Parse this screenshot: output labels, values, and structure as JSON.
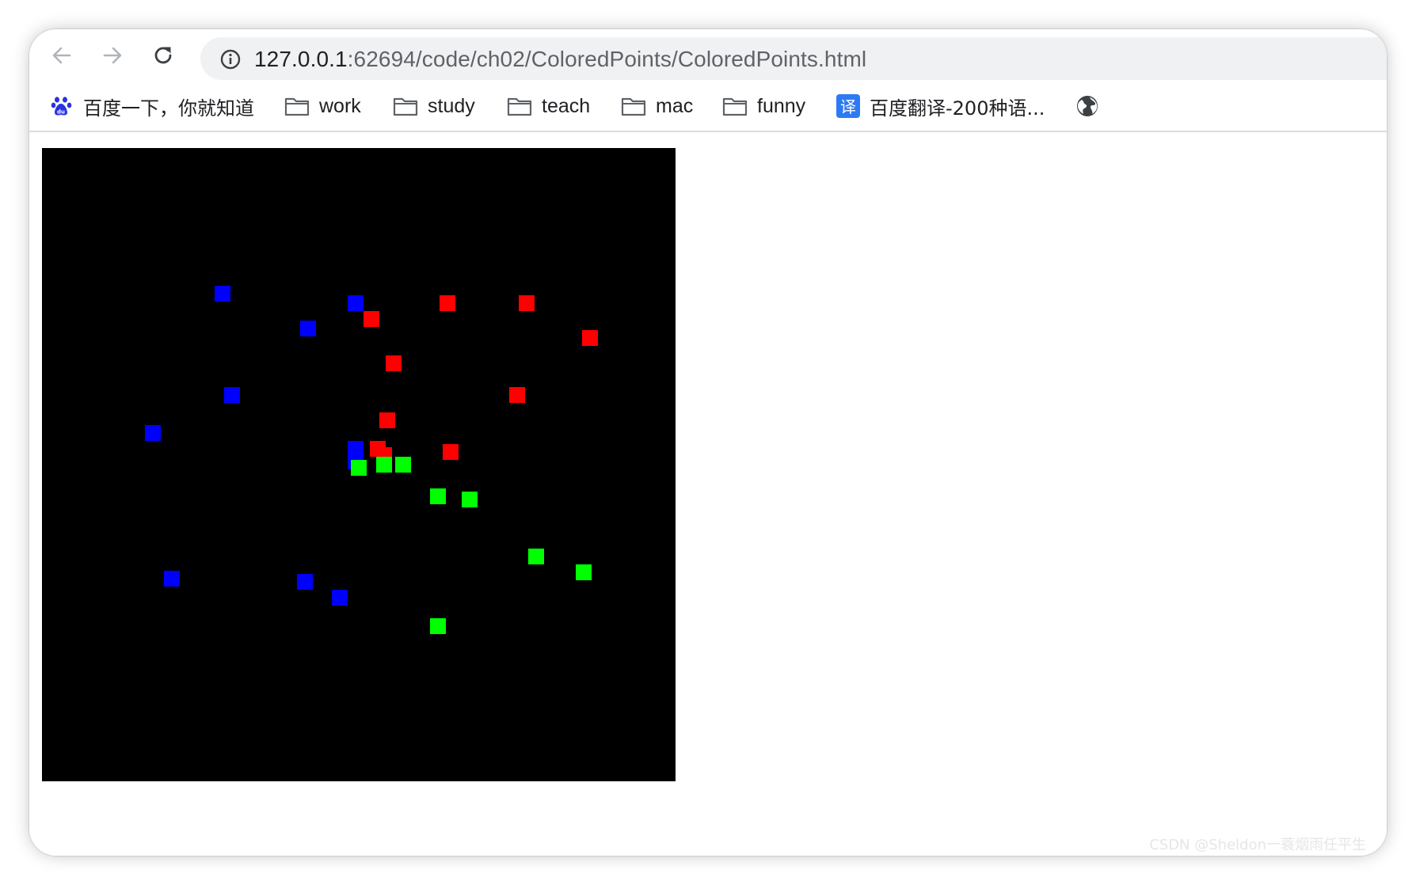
{
  "browser": {
    "url_host": "127.0.0.1",
    "url_rest": ":62694/code/ch02/ColoredPoints/ColoredPoints.html",
    "nav": {
      "back_icon": "back-arrow-icon",
      "forward_icon": "forward-arrow-icon",
      "reload_icon": "reload-icon",
      "site_info_icon": "info-circle-icon"
    }
  },
  "bookmarks": [
    {
      "label": "百度一下，你就知道",
      "icon": "baidu-paw-icon"
    },
    {
      "label": "work",
      "icon": "folder-icon"
    },
    {
      "label": "study",
      "icon": "folder-icon"
    },
    {
      "label": "teach",
      "icon": "folder-icon"
    },
    {
      "label": "mac",
      "icon": "folder-icon"
    },
    {
      "label": "funny",
      "icon": "folder-icon"
    },
    {
      "label": "百度翻译-200种语...",
      "icon": "translate-icon",
      "icon_text": "译"
    },
    {
      "label": "",
      "icon": "globe-icon"
    }
  ],
  "canvas": {
    "background": "#000000",
    "colors": {
      "red": "#ff0000",
      "green": "#00ff00",
      "blue": "#0000ff"
    },
    "points": [
      {
        "color": "blue",
        "x": -0.43,
        "y": 0.54
      },
      {
        "color": "blue",
        "x": -0.01,
        "y": 0.51
      },
      {
        "color": "red",
        "x": 0.04,
        "y": 0.46
      },
      {
        "color": "red",
        "x": 0.28,
        "y": 0.51
      },
      {
        "color": "red",
        "x": 0.53,
        "y": 0.51
      },
      {
        "color": "blue",
        "x": -0.16,
        "y": 0.43
      },
      {
        "color": "red",
        "x": 0.73,
        "y": 0.4
      },
      {
        "color": "red",
        "x": 0.11,
        "y": 0.32
      },
      {
        "color": "blue",
        "x": -0.4,
        "y": 0.22
      },
      {
        "color": "red",
        "x": 0.5,
        "y": 0.22
      },
      {
        "color": "red",
        "x": 0.09,
        "y": 0.14
      },
      {
        "color": "blue",
        "x": -0.65,
        "y": 0.1
      },
      {
        "color": "blue",
        "x": -0.01,
        "y": 0.05
      },
      {
        "color": "red",
        "x": 0.06,
        "y": 0.05
      },
      {
        "color": "red",
        "x": 0.08,
        "y": 0.03
      },
      {
        "color": "red",
        "x": 0.29,
        "y": 0.04
      },
      {
        "color": "blue",
        "x": -0.01,
        "y": 0.01
      },
      {
        "color": "green",
        "x": 0.0,
        "y": -0.01
      },
      {
        "color": "green",
        "x": 0.08,
        "y": 0.0
      },
      {
        "color": "green",
        "x": 0.14,
        "y": 0.0
      },
      {
        "color": "green",
        "x": 0.25,
        "y": -0.1
      },
      {
        "color": "green",
        "x": 0.35,
        "y": -0.11
      },
      {
        "color": "green",
        "x": 0.56,
        "y": -0.29
      },
      {
        "color": "green",
        "x": 0.71,
        "y": -0.34
      },
      {
        "color": "blue",
        "x": -0.59,
        "y": -0.36
      },
      {
        "color": "blue",
        "x": -0.17,
        "y": -0.37
      },
      {
        "color": "blue",
        "x": -0.06,
        "y": -0.42
      },
      {
        "color": "green",
        "x": 0.25,
        "y": -0.51
      }
    ]
  },
  "watermark": "CSDN @Sheldon一蓑烟雨任平生"
}
